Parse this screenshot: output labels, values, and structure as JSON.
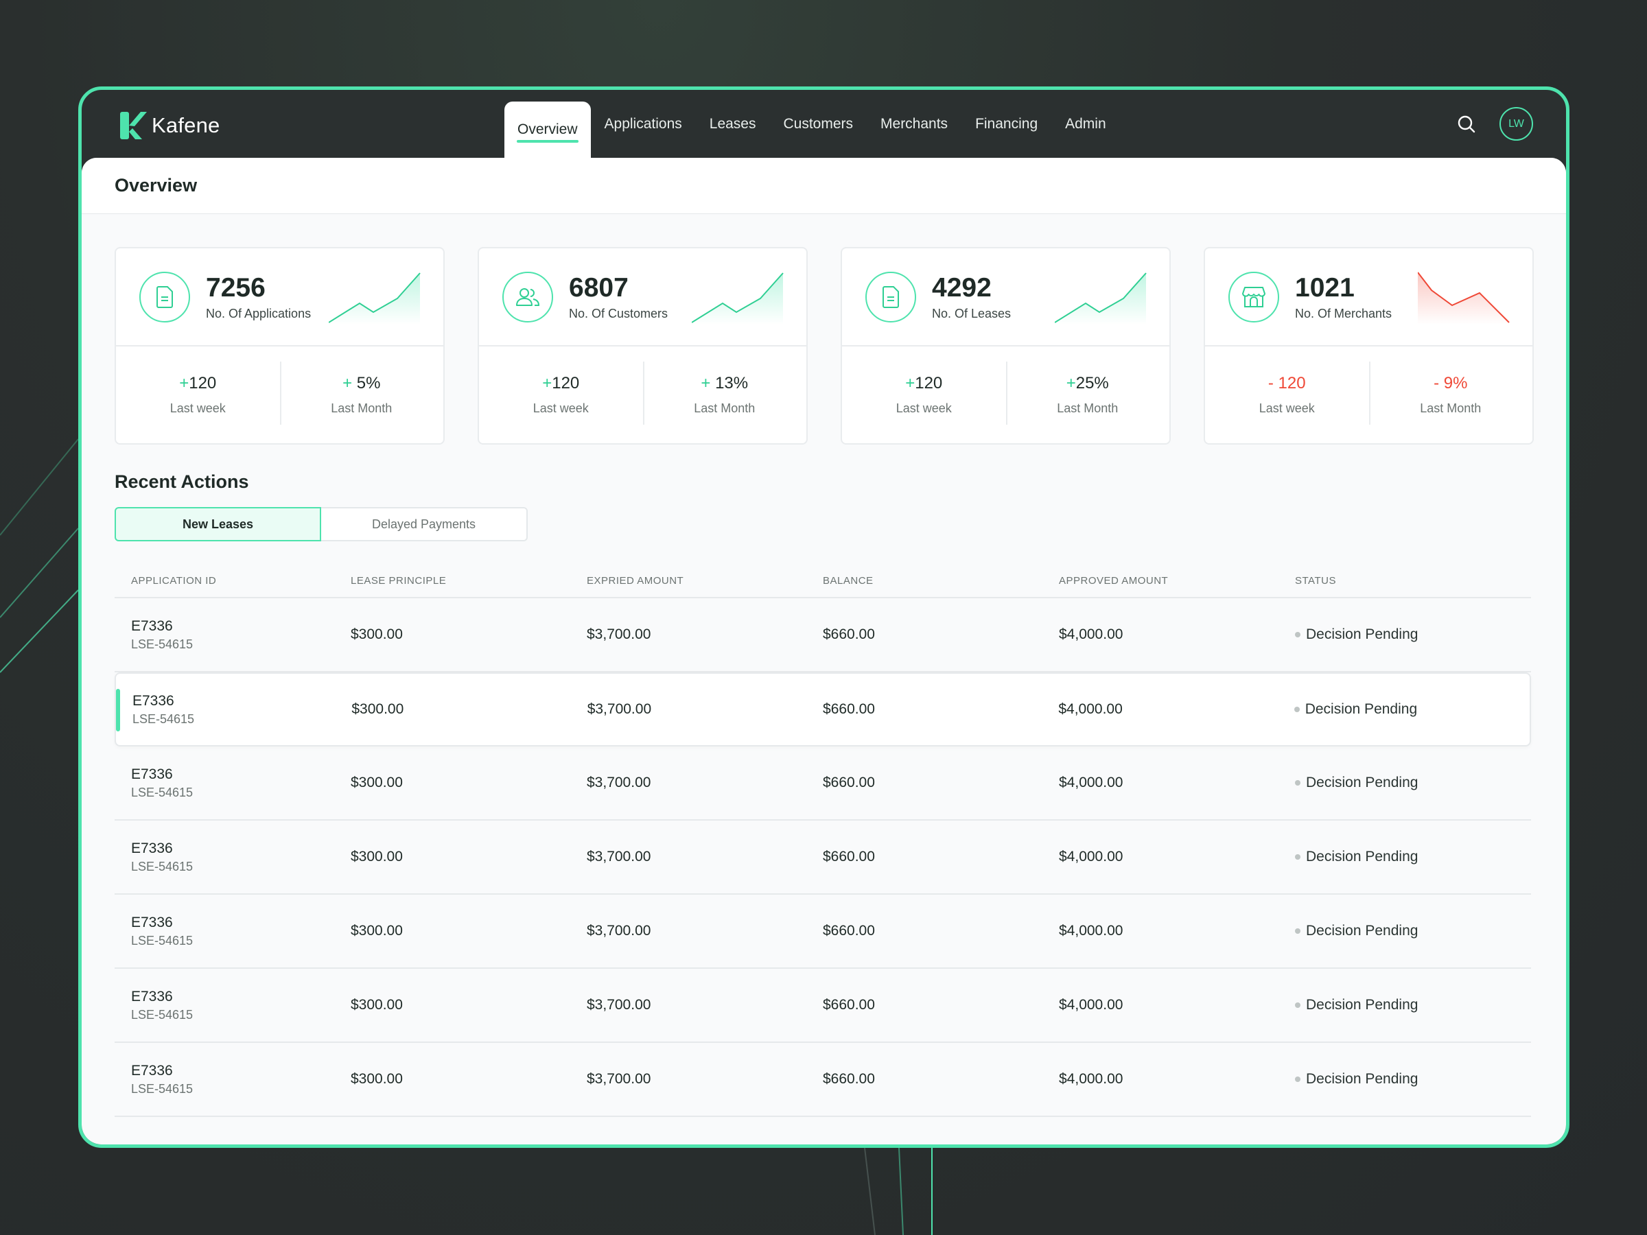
{
  "app": {
    "name": "Kafene",
    "user_initials": "LW",
    "accent": "#4ee3ad",
    "negative": "#ef4836"
  },
  "nav": {
    "items": [
      {
        "label": "Overview",
        "active": true
      },
      {
        "label": "Applications"
      },
      {
        "label": "Leases"
      },
      {
        "label": "Customers"
      },
      {
        "label": "Merchants"
      },
      {
        "label": "Financing"
      },
      {
        "label": "Admin"
      }
    ]
  },
  "page": {
    "title": "Overview"
  },
  "cards": [
    {
      "icon": "document-icon",
      "value": "7256",
      "label": "No. Of Applications",
      "trend": "up",
      "week": {
        "sign": "+",
        "value": "120",
        "label": "Last week"
      },
      "month": {
        "sign": "+ ",
        "value": "5%",
        "label": "Last Month"
      }
    },
    {
      "icon": "users-icon",
      "value": "6807",
      "label": "No. Of Customers",
      "trend": "up",
      "week": {
        "sign": "+",
        "value": "120",
        "label": "Last week"
      },
      "month": {
        "sign": "+ ",
        "value": "13%",
        "label": "Last Month"
      }
    },
    {
      "icon": "document-icon",
      "value": "4292",
      "label": "No. Of Leases",
      "trend": "up",
      "week": {
        "sign": "+",
        "value": "120",
        "label": "Last week"
      },
      "month": {
        "sign": "+",
        "value": "25%",
        "label": "Last Month"
      }
    },
    {
      "icon": "store-icon",
      "value": "1021",
      "label": "No. Of Merchants",
      "trend": "down",
      "week": {
        "sign": "",
        "value": "- 120",
        "label": "Last week"
      },
      "month": {
        "sign": "",
        "value": "- 9%",
        "label": "Last Month"
      }
    }
  ],
  "recent": {
    "title": "Recent Actions",
    "tabs": [
      {
        "label": "New Leases",
        "active": true
      },
      {
        "label": "Delayed Payments"
      }
    ],
    "columns": [
      "APPLICATION ID",
      "LEASE PRINCIPLE",
      "EXPRIED AMOUNT",
      "BALANCE",
      "APPROVED AMOUNT",
      "STATUS"
    ],
    "rows": [
      {
        "app_id": "E7336",
        "lease_id": "LSE-54615",
        "principle": "$300.00",
        "expired": "$3,700.00",
        "balance": "$660.00",
        "approved": "$4,000.00",
        "status": "Decision Pending"
      },
      {
        "app_id": "E7336",
        "lease_id": "LSE-54615",
        "principle": "$300.00",
        "expired": "$3,700.00",
        "balance": "$660.00",
        "approved": "$4,000.00",
        "status": "Decision Pending",
        "selected": true
      },
      {
        "app_id": "E7336",
        "lease_id": "LSE-54615",
        "principle": "$300.00",
        "expired": "$3,700.00",
        "balance": "$660.00",
        "approved": "$4,000.00",
        "status": "Decision Pending"
      },
      {
        "app_id": "E7336",
        "lease_id": "LSE-54615",
        "principle": "$300.00",
        "expired": "$3,700.00",
        "balance": "$660.00",
        "approved": "$4,000.00",
        "status": "Decision Pending"
      },
      {
        "app_id": "E7336",
        "lease_id": "LSE-54615",
        "principle": "$300.00",
        "expired": "$3,700.00",
        "balance": "$660.00",
        "approved": "$4,000.00",
        "status": "Decision Pending"
      },
      {
        "app_id": "E7336",
        "lease_id": "LSE-54615",
        "principle": "$300.00",
        "expired": "$3,700.00",
        "balance": "$660.00",
        "approved": "$4,000.00",
        "status": "Decision Pending"
      },
      {
        "app_id": "E7336",
        "lease_id": "LSE-54615",
        "principle": "$300.00",
        "expired": "$3,700.00",
        "balance": "$660.00",
        "approved": "$4,000.00",
        "status": "Decision Pending"
      }
    ]
  }
}
